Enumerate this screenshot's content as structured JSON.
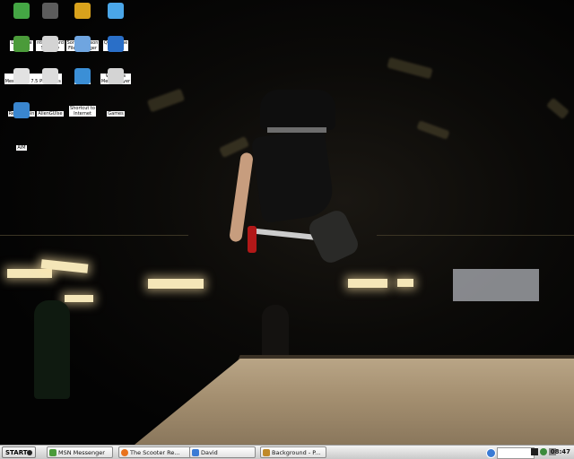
{
  "desktop_icons": [
    {
      "name": "icon-limewire",
      "label": "LimeWire\n4.12.6",
      "color": "#44a644"
    },
    {
      "name": "icon-ntinetguard",
      "label": "ntiNetguard\nSecurity",
      "color": "#5c5c5c"
    },
    {
      "name": "icon-sony-ericsson",
      "label": "Sony Ericsson\nFile Manager",
      "color": "#d9a21c"
    },
    {
      "name": "icon-quicktime",
      "label": "QuickTime\nPlayer",
      "color": "#4aa6e8"
    },
    {
      "name": "icon-msn",
      "label": "MSN\nMessenger 7.5",
      "color": "#4b9b3a"
    },
    {
      "name": "icon-other-programs",
      "label": "Other\nPrograms",
      "color": "#d4d4d4"
    },
    {
      "name": "icon-itunes",
      "label": "iTunes",
      "color": "#6fa5e0"
    },
    {
      "name": "icon-wmp",
      "label": "Windows\nMedia Player",
      "color": "#2a6fc8"
    },
    {
      "name": "icon-recycle-bin",
      "label": "Recycle Bin",
      "color": "#e2e2e2"
    },
    {
      "name": "icon-alienguise",
      "label": "AlienGUIse",
      "color": "#dcdcdc"
    },
    {
      "name": "icon-internet",
      "label": "Shortcut to\nInternet",
      "color": "#3b8fd6"
    },
    {
      "name": "icon-games",
      "label": "Games",
      "color": "#d4d4d4"
    },
    {
      "name": "icon-aim",
      "label": "AIM",
      "color": "#3a86cf"
    }
  ],
  "taskbar": {
    "start_label": "START",
    "tasks": [
      {
        "label": "MSN Messenger",
        "color": "#4b9b3a"
      },
      {
        "label": "The Scooter Re...",
        "color": "#e8721c"
      },
      {
        "label": "David",
        "color": "#3a7bd5"
      },
      {
        "label": "Background - P...",
        "color": "#c08a2a"
      }
    ],
    "clock": "08:47"
  }
}
